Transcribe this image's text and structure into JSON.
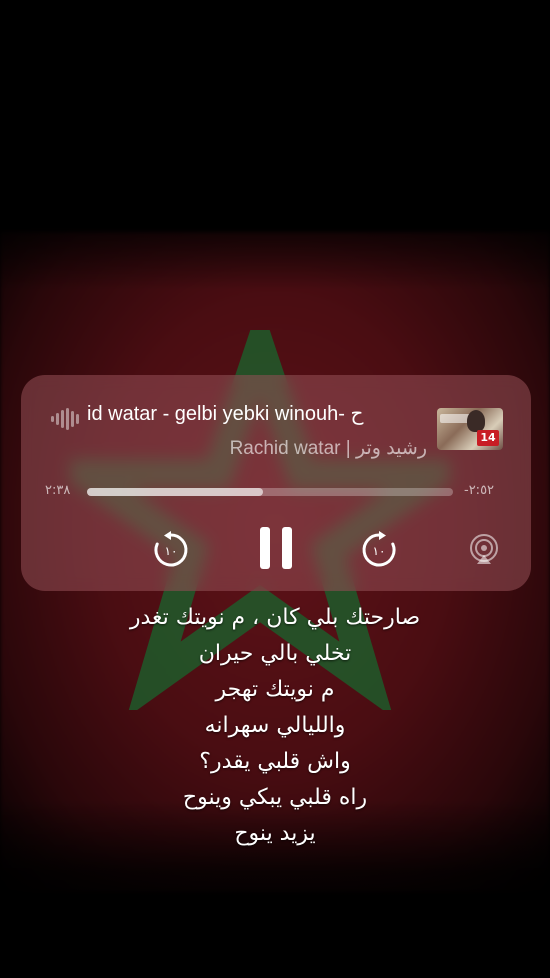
{
  "player": {
    "title": "id watar - gelbi yebki winouh- ح",
    "artist": "Rachid watar | رشيد وتر",
    "elapsed": "٢:٣٨",
    "remaining": "-٢:٥٢",
    "progress": 0.48,
    "skip_back_seconds": "١٠",
    "skip_forward_seconds": "١٠",
    "artwork_badge": "14"
  },
  "lyrics": [
    "صارحتك بلي كان ، م نويتك تغدر",
    "تخلي بالي حيران",
    "م نويتك تهجر",
    "والليالي سهرانه",
    "واش قلبي يقدر؟",
    "راه قلبي يبكي وينوح",
    "يزيد ينوح"
  ],
  "colors": {
    "flag_red": "#5e1218",
    "star_green": "#1e5a2a",
    "player_bg": "#965058"
  }
}
